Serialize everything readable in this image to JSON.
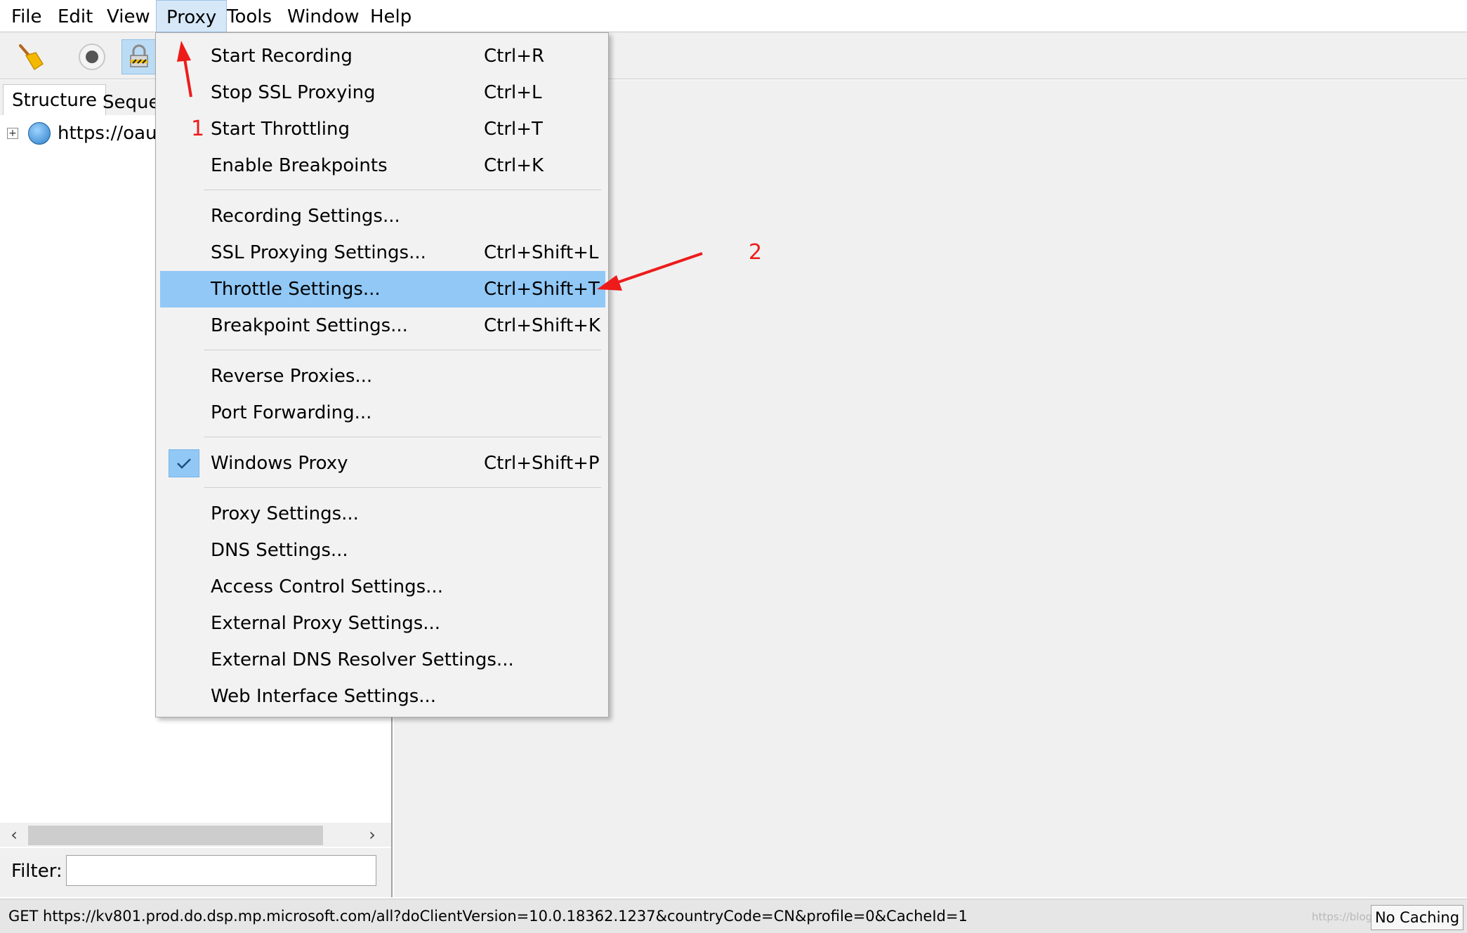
{
  "menubar": {
    "items": [
      "File",
      "Edit",
      "View",
      "Proxy",
      "Tools",
      "Window",
      "Help"
    ]
  },
  "toolbar": {
    "buttons": [
      {
        "icon": "broom-icon"
      },
      {
        "icon": "record-icon"
      },
      {
        "icon": "ssl-lock-icon"
      }
    ]
  },
  "left_panel": {
    "tabs": [
      "Structure",
      "Sequer"
    ],
    "tree_item": "https://oaut",
    "filter_label": "Filter:",
    "filter_value": ""
  },
  "proxy_menu": {
    "groups": [
      [
        {
          "label": "Start Recording",
          "shortcut": "Ctrl+R"
        },
        {
          "label": "Stop SSL Proxying",
          "shortcut": "Ctrl+L"
        },
        {
          "label": "Start Throttling",
          "shortcut": "Ctrl+T"
        },
        {
          "label": "Enable Breakpoints",
          "shortcut": "Ctrl+K"
        }
      ],
      [
        {
          "label": "Recording Settings...",
          "shortcut": ""
        },
        {
          "label": "SSL Proxying Settings...",
          "shortcut": "Ctrl+Shift+L"
        },
        {
          "label": "Throttle Settings...",
          "shortcut": "Ctrl+Shift+T"
        },
        {
          "label": "Breakpoint Settings...",
          "shortcut": "Ctrl+Shift+K"
        }
      ],
      [
        {
          "label": "Reverse Proxies...",
          "shortcut": ""
        },
        {
          "label": "Port Forwarding...",
          "shortcut": ""
        }
      ],
      [
        {
          "label": "Windows Proxy",
          "shortcut": "Ctrl+Shift+P"
        }
      ],
      [
        {
          "label": "Proxy Settings...",
          "shortcut": ""
        },
        {
          "label": "DNS Settings...",
          "shortcut": ""
        },
        {
          "label": "Access Control Settings...",
          "shortcut": ""
        },
        {
          "label": "External Proxy Settings...",
          "shortcut": ""
        },
        {
          "label": "External DNS Resolver Settings...",
          "shortcut": ""
        },
        {
          "label": "Web Interface Settings...",
          "shortcut": ""
        }
      ]
    ],
    "highlighted": "Throttle Settings...",
    "checked": "Windows Proxy"
  },
  "annotations": {
    "step1": "1",
    "step2": "2",
    "color": "#ee1b1b"
  },
  "statusbar": {
    "text": "GET https://kv801.prod.do.dsp.mp.microsoft.com/all?doClientVersion=10.0.18362.1237&countryCode=CN&profile=0&CacheId=1",
    "watermark": "https://blog.csdn.net/",
    "caching_button": "No Caching"
  },
  "colors": {
    "menu_highlight": "#91c8f6",
    "menubar_active": "#d6e8f7",
    "panel_bg": "#f0f0f0"
  }
}
